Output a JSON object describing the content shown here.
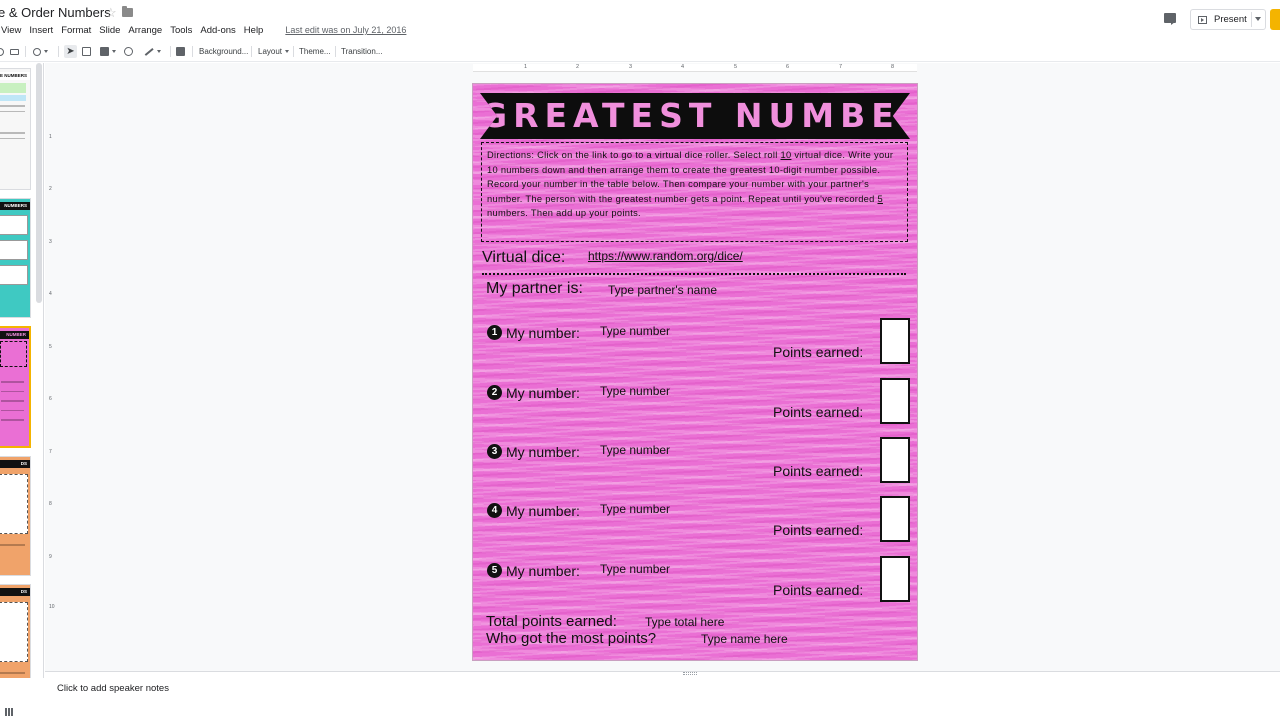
{
  "app": {
    "doc_title": "e & Order Numbers",
    "last_edit": "Last edit was on July 21, 2016",
    "present_label": "Present",
    "speaker_notes": "Click to add speaker notes"
  },
  "menu": [
    "View",
    "Insert",
    "Format",
    "Slide",
    "Arrange",
    "Tools",
    "Add-ons",
    "Help"
  ],
  "toolbar": {
    "background": "Background...",
    "layout": "Layout",
    "theme": "Theme...",
    "transition": "Transition..."
  },
  "ruler": {
    "h": [
      "1",
      "2",
      "3",
      "4",
      "5",
      "6",
      "7",
      "8"
    ],
    "v": [
      "1",
      "2",
      "3",
      "4",
      "5",
      "6",
      "7",
      "8",
      "9",
      "10"
    ]
  },
  "filmstrip": [
    {
      "title": "E NUMBERS",
      "color": "#f7f7f7",
      "bar": "#ffffff"
    },
    {
      "title": "NUMBERS",
      "color": "#3fc9c2",
      "bar": "#111111"
    },
    {
      "title": "NUMBER",
      "color": "#ea6fd4",
      "bar": "#111111",
      "selected": true
    },
    {
      "title": "DS",
      "color": "#f0a36a",
      "bar": "#111111"
    },
    {
      "title": "DS",
      "color": "#f0a36a",
      "bar": "#111111"
    }
  ],
  "slide": {
    "title": "GREATEST NUMBER",
    "directions": {
      "p1": "Directions: Click on the link to go to a virtual dice roller. Select roll ",
      "n1": "10",
      "p2": " virtual dice. Write your 10 numbers down and then arrange them to create the greatest 10-digit number possible. Record your number in the table below. Then compare your number with your partner's number. The person with the greatest number gets a point. Repeat until you've recorded ",
      "n2": "5",
      "p3": " numbers. Then add up your points."
    },
    "virtual_dice_label": "Virtual dice:",
    "virtual_dice_link": "https://www.random.org/dice/",
    "partner_label": "My partner is:",
    "partner_placeholder": "Type partner's name",
    "rows": [
      {
        "num": "1",
        "label": "My number:",
        "placeholder": "Type number",
        "points_label": "Points earned:"
      },
      {
        "num": "2",
        "label": "My number:",
        "placeholder": "Type number",
        "points_label": "Points earned:"
      },
      {
        "num": "3",
        "label": "My number:",
        "placeholder": "Type number",
        "points_label": "Points earned:"
      },
      {
        "num": "4",
        "label": "My number:",
        "placeholder": "Type number",
        "points_label": "Points earned:"
      },
      {
        "num": "5",
        "label": "My number:",
        "placeholder": "Type number",
        "points_label": "Points earned:"
      }
    ],
    "total_label": "Total points earned:",
    "total_placeholder": "Type total here",
    "most_label": "Who got the most points?",
    "most_placeholder": "Type name here"
  },
  "colors": {
    "slide_pink": "#ea6fd4",
    "banner_black": "#0d0d0d",
    "title_pink": "#f08fdc",
    "selected_border": "#f4b400"
  }
}
